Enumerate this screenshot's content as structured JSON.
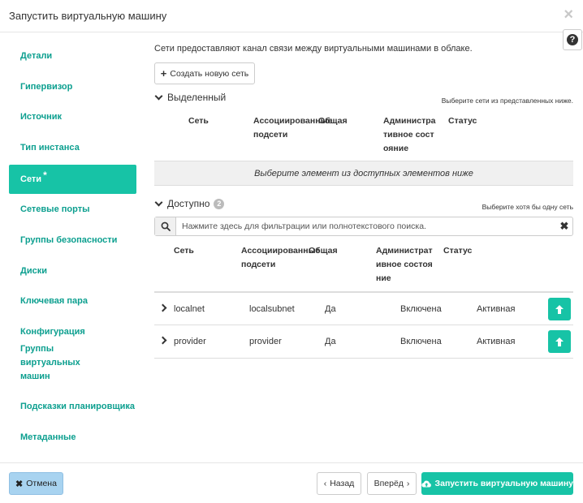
{
  "dialog": {
    "title": "Запустить виртуальную машину",
    "close_glyph": "×",
    "help_glyph": "?"
  },
  "sidebar": {
    "items": [
      {
        "label": "Детали"
      },
      {
        "label": "Гипервизор"
      },
      {
        "label": "Источник"
      },
      {
        "label": "Тип инстанса"
      },
      {
        "label": "Сети",
        "required_mark": "*",
        "active": true
      },
      {
        "label": "Сетевые порты"
      },
      {
        "label": "Группы безопасности"
      },
      {
        "label": "Диски"
      },
      {
        "label": "Ключевая пара"
      },
      {
        "label": "Конфигурация"
      },
      {
        "label": "Группы виртуальных машин"
      },
      {
        "label": "Подсказки планировщика"
      },
      {
        "label": "Метаданные"
      }
    ]
  },
  "main": {
    "intro": "Сети предоставляют канал связи между виртуальными машинами в облаке.",
    "create_network_label": "Создать новую сеть",
    "allocated": {
      "title": "Выделенный",
      "hint": "Выберите сети из представленных ниже.",
      "columns": [
        "Сеть",
        "Ассоциированные подсети",
        "Общая",
        "Административное состояние",
        "Статус"
      ],
      "empty_text": "Выберите элемент из доступных элементов ниже"
    },
    "available": {
      "title": "Доступно",
      "count": "2",
      "hint": "Выберите хотя бы одну сеть",
      "search_placeholder": "Нажмите здесь для фильтрации или полнотекстового поиска.",
      "clear_glyph": "✖",
      "columns": [
        "Сеть",
        "Ассоциированные подсети",
        "Общая",
        "Административное состояние",
        "Статус"
      ],
      "rows": [
        {
          "network": "localnet",
          "subnets": "localsubnet",
          "shared": "Да",
          "admin_state": "Включена",
          "status": "Активная"
        },
        {
          "network": "provider",
          "subnets": "provider",
          "shared": "Да",
          "admin_state": "Включена",
          "status": "Активная"
        }
      ]
    }
  },
  "footer": {
    "cancel_label": "Отмена",
    "back_label": "Назад",
    "next_label": "Вперёд",
    "launch_label": "Запустить виртуальную машину"
  },
  "colors": {
    "accent": "#17c3a6",
    "sidebar_link": "#0c9f8f",
    "cancel_bg": "#a8d3f0"
  }
}
